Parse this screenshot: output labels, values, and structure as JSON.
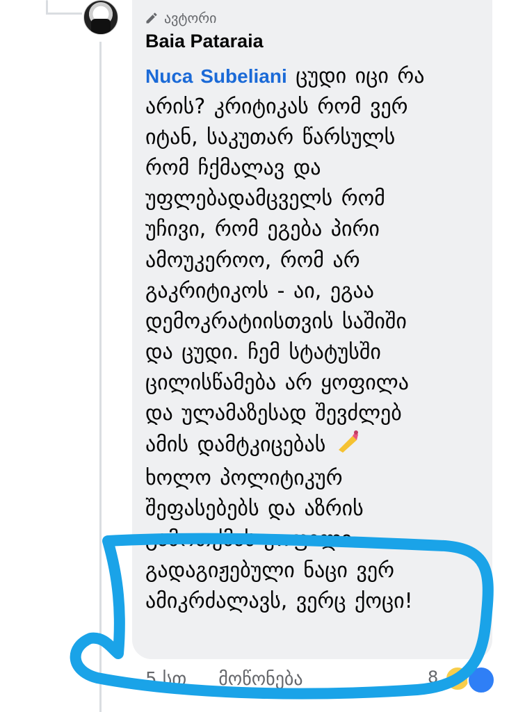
{
  "comment": {
    "badge_label": "ავტორი",
    "author": "Baia Pataraia",
    "mention": "Nuca Subeliani",
    "lines": [
      " ცუდი იცი რა",
      "არის? კრიტიკას რომ ვერ",
      "იტან, საკუთარ წარსულს",
      "რომ ჩქმალავ და",
      "უფლებადამცველს რომ",
      "უჩივი, რომ ეგება პირი",
      "ამოუკეროო, რომ არ",
      "გაკრიტიკოს - აი, ეგაა",
      "დემოკრატიისთვის საშიში",
      "და ცუდი. ჩემ სტატუსში",
      "ცილისწამება არ ყოფილა",
      "და ულამაზესად შევძლებ",
      "ამის დამტკიცებას ",
      "ხოლო პოლიტიკურ",
      "შეფასებებს და აზრის",
      "გამოთქმას ყოფილი",
      "გადაგიჟებული ნაცი ვერ",
      "ამიკრძალავს, ვერც ქოცი!"
    ],
    "emoji_icon": "nail-polish-icon"
  },
  "footer": {
    "time": "5 სთ",
    "like": "მოწონება",
    "reaction_count": "8"
  },
  "colors": {
    "bubble": "#eff0f2",
    "mention": "#1b6ad7",
    "highlight": "#1aa3e8"
  }
}
